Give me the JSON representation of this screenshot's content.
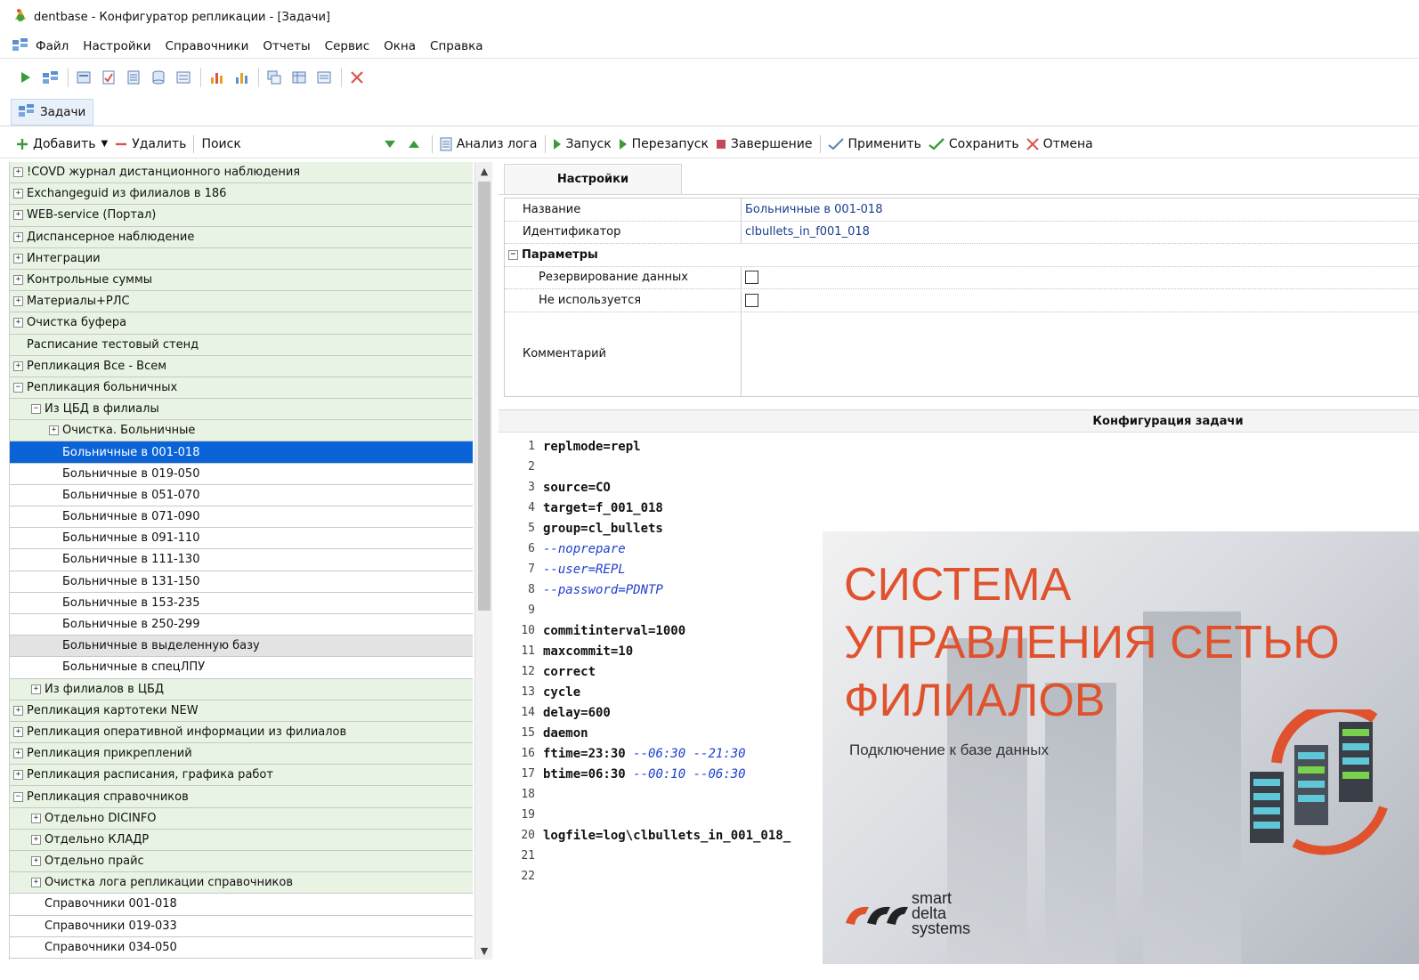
{
  "window": {
    "title": "dentbase - Конфигуратор репликации - [Задачи]"
  },
  "menu": [
    "Файл",
    "Настройки",
    "Справочники",
    "Отчеты",
    "Сервис",
    "Окна",
    "Справка"
  ],
  "doc_tab": {
    "label": "Задачи"
  },
  "actions": {
    "add": "Добавить",
    "delete": "Удалить",
    "search": "Поиск",
    "log_analysis": "Анализ лога",
    "start": "Запуск",
    "restart": "Перезапуск",
    "stop": "Завершение",
    "apply": "Применить",
    "save": "Сохранить",
    "cancel": "Отмена"
  },
  "tree": [
    {
      "label": "!COVD журнал дистанционного наблюдения",
      "level": 0,
      "kind": "group",
      "expander": "+"
    },
    {
      "label": "Exchangeguid из филиалов в 186",
      "level": 0,
      "kind": "group",
      "expander": "+"
    },
    {
      "label": "WEB-service (Портал)",
      "level": 0,
      "kind": "group",
      "expander": "+"
    },
    {
      "label": "Диспансерное наблюдение",
      "level": 0,
      "kind": "group",
      "expander": "+"
    },
    {
      "label": "Интеграции",
      "level": 0,
      "kind": "group",
      "expander": "+"
    },
    {
      "label": "Контрольные суммы",
      "level": 0,
      "kind": "group",
      "expander": "+"
    },
    {
      "label": "Материалы+РЛС",
      "level": 0,
      "kind": "group",
      "expander": "+"
    },
    {
      "label": "Очистка буфера",
      "level": 0,
      "kind": "group",
      "expander": "+"
    },
    {
      "label": "Расписание тестовый стенд",
      "level": 0,
      "kind": "group",
      "expander": ""
    },
    {
      "label": "Репликация Все - Всем",
      "level": 0,
      "kind": "group",
      "expander": "+"
    },
    {
      "label": "Репликация больничных",
      "level": 0,
      "kind": "group",
      "expander": "−"
    },
    {
      "label": "Из ЦБД в филиалы",
      "level": 1,
      "kind": "group",
      "expander": "−"
    },
    {
      "label": "Очистка. Больничные",
      "level": 2,
      "kind": "group",
      "expander": "+"
    },
    {
      "label": "Больничные в 001-018",
      "level": 2,
      "kind": "selected",
      "expander": ""
    },
    {
      "label": "Больничные в 019-050",
      "level": 2,
      "kind": "leaf",
      "expander": ""
    },
    {
      "label": "Больничные в 051-070",
      "level": 2,
      "kind": "leaf",
      "expander": ""
    },
    {
      "label": "Больничные в 071-090",
      "level": 2,
      "kind": "leaf",
      "expander": ""
    },
    {
      "label": "Больничные в 091-110",
      "level": 2,
      "kind": "leaf",
      "expander": ""
    },
    {
      "label": "Больничные в 111-130",
      "level": 2,
      "kind": "leaf",
      "expander": ""
    },
    {
      "label": "Больничные в 131-150",
      "level": 2,
      "kind": "leaf",
      "expander": ""
    },
    {
      "label": "Больничные в 153-235",
      "level": 2,
      "kind": "leaf",
      "expander": ""
    },
    {
      "label": "Больничные в 250-299",
      "level": 2,
      "kind": "leaf",
      "expander": ""
    },
    {
      "label": "Больничные в выделенную базу",
      "level": 2,
      "kind": "grey",
      "expander": ""
    },
    {
      "label": "Больничные в спецЛПУ",
      "level": 2,
      "kind": "leaf",
      "expander": ""
    },
    {
      "label": "Из филиалов в ЦБД",
      "level": 1,
      "kind": "group",
      "expander": "+"
    },
    {
      "label": "Репликация картотеки NEW",
      "level": 0,
      "kind": "group",
      "expander": "+"
    },
    {
      "label": "Репликация оперативной информации из филиалов",
      "level": 0,
      "kind": "group",
      "expander": "+"
    },
    {
      "label": "Репликация прикреплений",
      "level": 0,
      "kind": "group",
      "expander": "+"
    },
    {
      "label": "Репликация расписания, графика работ",
      "level": 0,
      "kind": "group",
      "expander": "+"
    },
    {
      "label": "Репликация справочников",
      "level": 0,
      "kind": "group",
      "expander": "−"
    },
    {
      "label": "Отдельно DICINFO",
      "level": 1,
      "kind": "group",
      "expander": "+"
    },
    {
      "label": "Отдельно КЛАДР",
      "level": 1,
      "kind": "group",
      "expander": "+"
    },
    {
      "label": "Отдельно прайс",
      "level": 1,
      "kind": "group",
      "expander": "+"
    },
    {
      "label": "Очистка лога репликации справочников",
      "level": 1,
      "kind": "group",
      "expander": "+"
    },
    {
      "label": "Справочники 001-018",
      "level": 1,
      "kind": "leaf",
      "expander": ""
    },
    {
      "label": "Справочники 019-033",
      "level": 1,
      "kind": "leaf",
      "expander": ""
    },
    {
      "label": "Справочники 034-050",
      "level": 1,
      "kind": "leaf",
      "expander": ""
    }
  ],
  "settings": {
    "tab_label": "Настройки",
    "name_label": "Название",
    "name_value": "Больничные в 001-018",
    "id_label": "Идентификатор",
    "id_value": "clbullets_in_f001_018",
    "params_label": "Параметры",
    "backup_label": "Резервирование данных",
    "backup_checked": false,
    "unused_label": "Не используется",
    "unused_checked": false,
    "comment_label": "Комментарий"
  },
  "config": {
    "header": "Конфигурация задачи",
    "lines": [
      {
        "n": "1",
        "text": "replmode=repl",
        "comment": ""
      },
      {
        "n": "2",
        "text": "",
        "comment": ""
      },
      {
        "n": "3",
        "text": "source=CO",
        "comment": ""
      },
      {
        "n": "4",
        "text": "target=f_001_018",
        "comment": ""
      },
      {
        "n": "5",
        "text": "group=cl_bullets",
        "comment": ""
      },
      {
        "n": "6",
        "text": "",
        "comment": "--noprepare"
      },
      {
        "n": "7",
        "text": "",
        "comment": "--user=REPL"
      },
      {
        "n": "8",
        "text": "",
        "comment": "--password=PDNTP"
      },
      {
        "n": "9",
        "text": "",
        "comment": ""
      },
      {
        "n": "10",
        "text": "commitinterval=1000",
        "comment": ""
      },
      {
        "n": "11",
        "text": "maxcommit=10",
        "comment": ""
      },
      {
        "n": "12",
        "text": "correct",
        "comment": ""
      },
      {
        "n": "13",
        "text": "cycle",
        "comment": ""
      },
      {
        "n": "14",
        "text": "delay=600",
        "comment": ""
      },
      {
        "n": "15",
        "text": "daemon",
        "comment": ""
      },
      {
        "n": "16",
        "text": "ftime=23:30 ",
        "comment": "--06:30 --21:30"
      },
      {
        "n": "17",
        "text": "btime=06:30 ",
        "comment": "--00:10 --06:30"
      },
      {
        "n": "18",
        "text": "",
        "comment": ""
      },
      {
        "n": "19",
        "text": "",
        "comment": ""
      },
      {
        "n": "20",
        "text": "logfile=log\\clbullets_in_001_018_",
        "comment": ""
      },
      {
        "n": "21",
        "text": "",
        "comment": ""
      },
      {
        "n": "22",
        "text": "",
        "comment": ""
      }
    ]
  },
  "splash": {
    "line1": "СИСТЕМА",
    "line2": "УПРАВЛЕНИЯ СЕТЬЮ",
    "line3": "ФИЛИАЛОВ",
    "subtitle": "Подключение к базе данных",
    "logo_word1": "smart",
    "logo_word2": "delta",
    "logo_word3": "systems"
  },
  "colors": {
    "selection": "#0a64d8",
    "group_row": "#e8f3e3",
    "splash_accent": "#e0522d",
    "comment": "#1f3fcf"
  }
}
